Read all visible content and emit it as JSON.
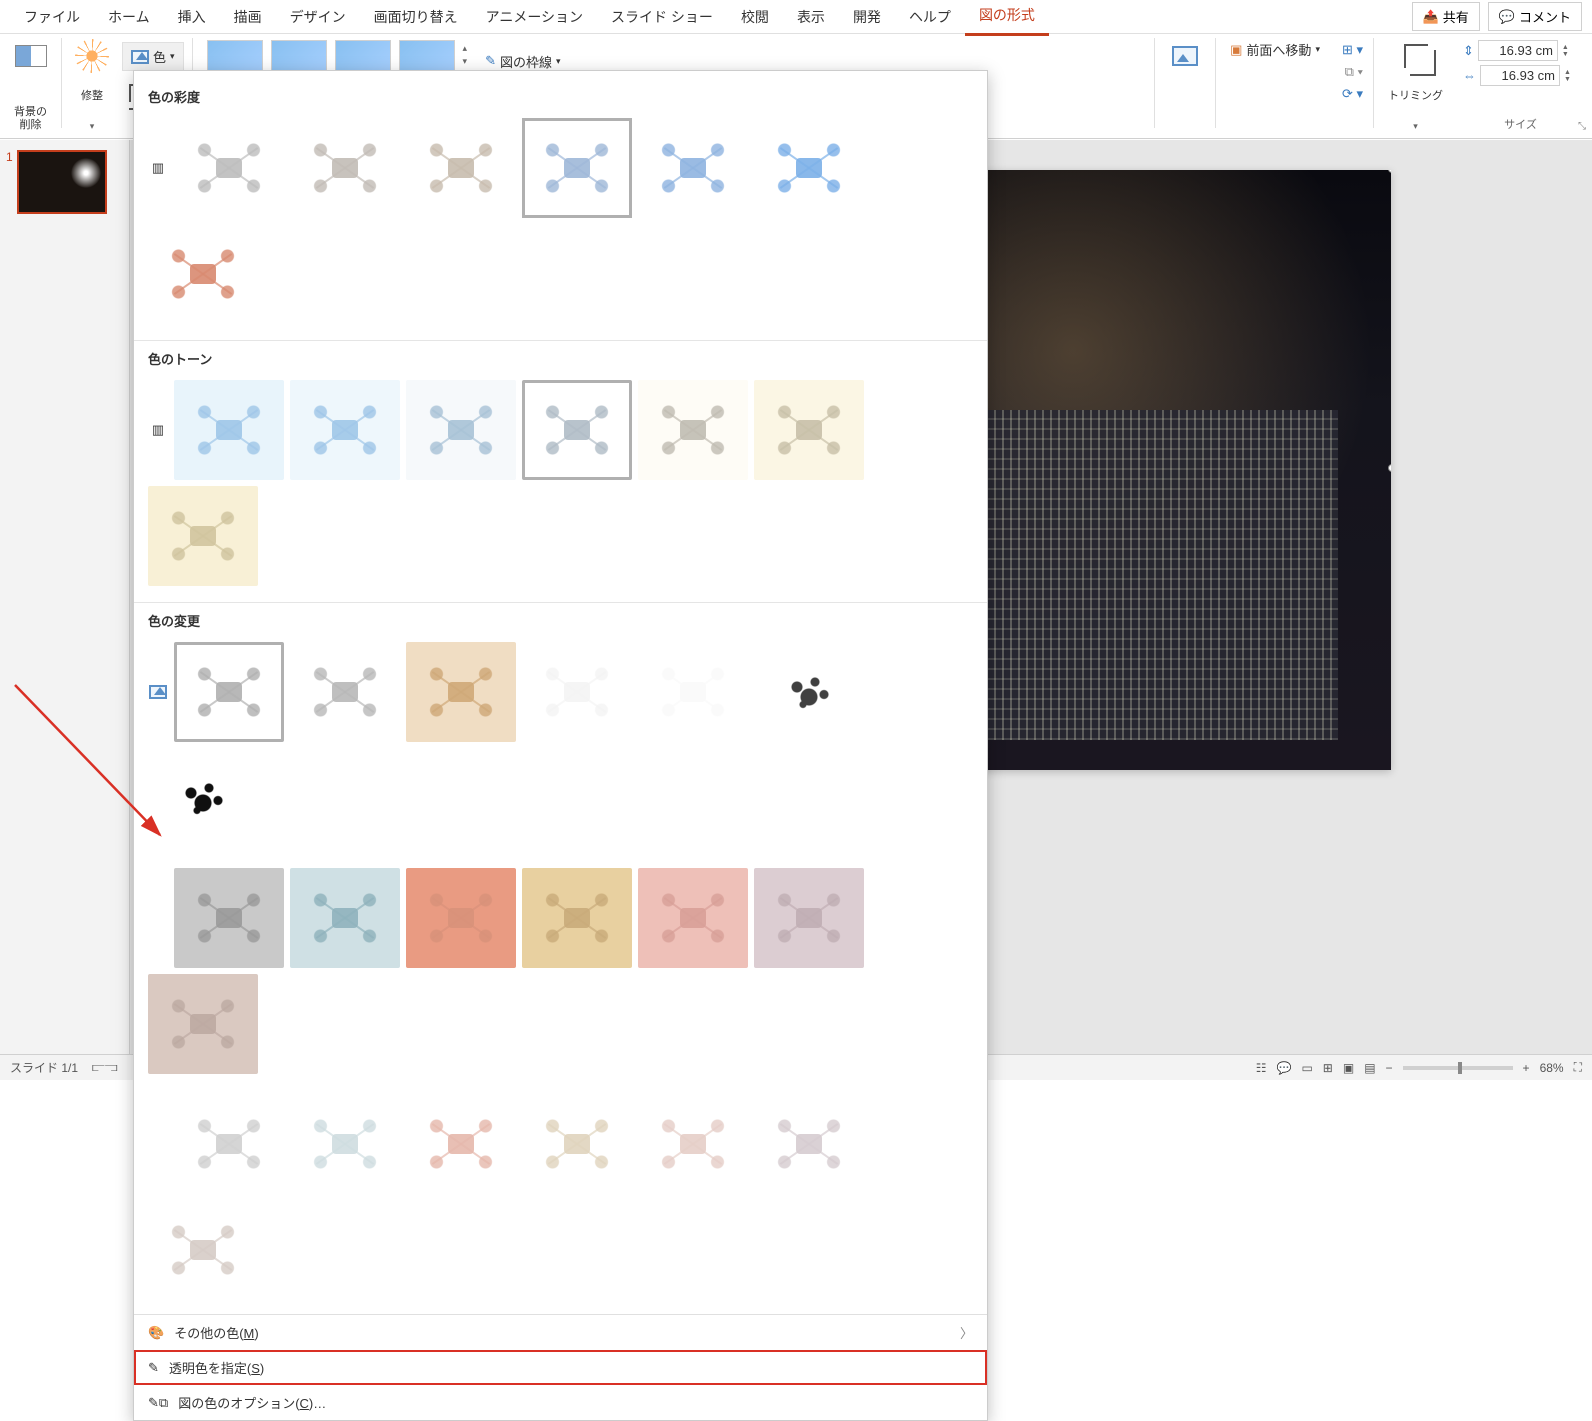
{
  "tabs": {
    "file": "ファイル",
    "home": "ホーム",
    "insert": "挿入",
    "draw": "描画",
    "design": "デザイン",
    "transition": "画面切り替え",
    "animation": "アニメーション",
    "slideshow": "スライド ショー",
    "review": "校閲",
    "view": "表示",
    "developer": "開発",
    "help": "ヘルプ",
    "format": "図の形式",
    "share": "共有",
    "comment": "コメント"
  },
  "toolbar": {
    "remove_bg": "背景の\n削除",
    "corrections": "修整",
    "color": "色",
    "outline": "図の枠線",
    "bring_front": "前面へ移動",
    "crop": "トリミング",
    "size_group": "サイズ",
    "width": "16.93 cm",
    "height": "16.93 cm"
  },
  "panel": {
    "saturation_head": "色の彩度",
    "tone_head": "色のトーン",
    "recolor_head": "色の変更",
    "more_colors": "その他の色(",
    "more_colors_u": "M",
    "more_colors_end": ")",
    "set_transparent": "透明色を指定(",
    "set_transparent_u": "S",
    "set_transparent_end": ")",
    "color_options": "図の色のオプション(",
    "color_options_u": "C",
    "color_options_end": ")…"
  },
  "swatches": {
    "saturation": [
      {
        "c": "#bdbdbd"
      },
      {
        "c": "#c2bcb6"
      },
      {
        "c": "#c8bcae"
      },
      {
        "c": "#9fb8d8",
        "sel": true
      },
      {
        "c": "#8fb4e0"
      },
      {
        "c": "#7cb0e8"
      },
      {
        "c": "#d88a70"
      }
    ],
    "tone": [
      {
        "c": "#9fc6e8",
        "bg": "#e8f4fb"
      },
      {
        "c": "#9fc6e8",
        "bg": "#eef7fc"
      },
      {
        "c": "#a8c2d6",
        "bg": "#f6f9fb"
      },
      {
        "c": "#b0bcc6",
        "bg": "#ffffff",
        "sel": true
      },
      {
        "c": "#c0bcb2",
        "bg": "#fefcf6"
      },
      {
        "c": "#c8c0a8",
        "bg": "#fbf6e4"
      },
      {
        "c": "#d0c49e",
        "bg": "#f8f0d6"
      }
    ],
    "recolor_rows": [
      [
        {
          "c": "#b0b0b0",
          "bg": "#ffffff",
          "sel": true
        },
        {
          "c": "#b8b8b8",
          "bg": "#ffffff"
        },
        {
          "c": "#cfa878",
          "bg": "#f0ddc3"
        },
        {
          "c": "#f4f4f4",
          "bg": "#ffffff"
        },
        {
          "c": "#fafafa",
          "bg": "#ffffff"
        },
        {
          "c": "#404040",
          "bg": "#ffffff",
          "splat": true
        },
        {
          "c": "#101010",
          "bg": "#ffffff",
          "splat": true
        }
      ],
      [
        {
          "c": "#9a9a9a",
          "bg": "#c9c9c9"
        },
        {
          "c": "#8fb2bc",
          "bg": "#cfe0e4"
        },
        {
          "c": "#d8927a",
          "bg": "#e99b82"
        },
        {
          "c": "#c9ab7a",
          "bg": "#e8d0a0"
        },
        {
          "c": "#d8a098",
          "bg": "#eec0b8"
        },
        {
          "c": "#c0aeb4",
          "bg": "#dccdd2"
        },
        {
          "c": "#bdaaa2",
          "bg": "#dac9c1"
        }
      ],
      [
        {
          "c": "#d0d0d0",
          "bg": "#ffffff"
        },
        {
          "c": "#cfdde0",
          "bg": "#ffffff"
        },
        {
          "c": "#e6b8ac",
          "bg": "#ffffff"
        },
        {
          "c": "#e0d4be",
          "bg": "#ffffff"
        },
        {
          "c": "#e6cec8",
          "bg": "#ffffff"
        },
        {
          "c": "#d6ccd0",
          "bg": "#ffffff"
        },
        {
          "c": "#d6ccc6",
          "bg": "#ffffff"
        }
      ]
    ]
  },
  "status": {
    "slide": "スライド 1/1",
    "zoom": "68%"
  },
  "thumb": {
    "num": "1"
  }
}
